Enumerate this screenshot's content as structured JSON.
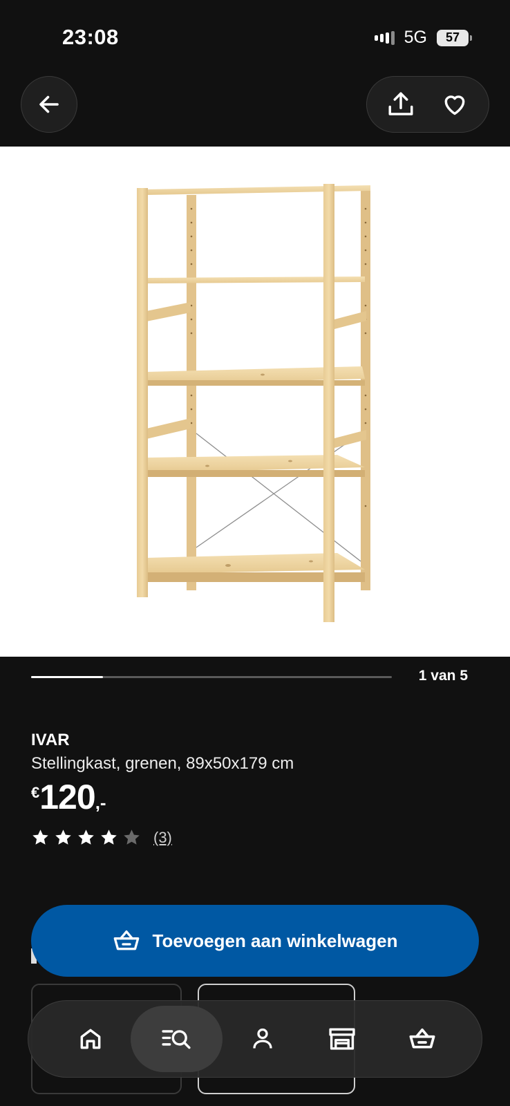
{
  "status_bar": {
    "time": "23:08",
    "network": "5G",
    "battery": "57"
  },
  "top_nav": {
    "back_icon": "arrow-left-icon",
    "share_icon": "share-icon",
    "wishlist_icon": "heart-icon"
  },
  "gallery": {
    "counter": "1 van 5",
    "progress": 0.2
  },
  "product": {
    "name": "IVAR",
    "description": "Stellingkast, grenen, 89x50x179 cm",
    "price_currency": "€",
    "price_amount": "120",
    "price_suffix": ",-",
    "rating_stars": 4,
    "rating_max": 5,
    "rating_count": "(3)"
  },
  "add_to_cart": {
    "label": "Toevoegen aan winkelwagen",
    "icon": "basket-icon"
  },
  "tab_bar": {
    "items": [
      {
        "name": "home",
        "icon": "home-icon",
        "active": false
      },
      {
        "name": "search",
        "icon": "search-list-icon",
        "active": true
      },
      {
        "name": "account",
        "icon": "person-icon",
        "active": false
      },
      {
        "name": "store",
        "icon": "store-icon",
        "active": false
      },
      {
        "name": "cart",
        "icon": "basket-icon",
        "active": false
      }
    ]
  },
  "colors": {
    "background": "#111111",
    "primary_button": "#0058a3",
    "image_bg": "#ffffff"
  }
}
